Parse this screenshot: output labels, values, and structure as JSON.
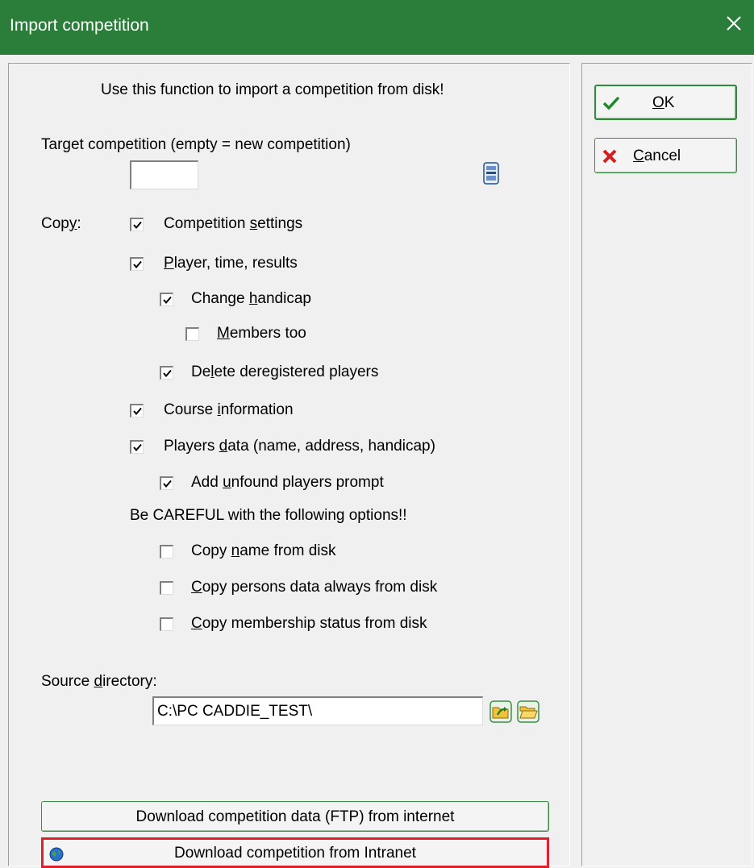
{
  "window": {
    "title": "Import competition",
    "close_glyph": "×"
  },
  "colors": {
    "titlebar": "#2b7d3a",
    "highlight_border": "#e0202a",
    "button_border": "#3a8f43"
  },
  "intro_text": "Use this function to import a competition from disk!",
  "target": {
    "label": "Target competition (empty = new competition)",
    "value": "",
    "picker_icon": "list-picker-icon"
  },
  "copy": {
    "label_prefix": "Cop",
    "label_mnemonic": "y",
    "label_suffix": ":",
    "options": [
      {
        "pre": "Competition ",
        "mn": "s",
        "post": "ettings",
        "checked": true
      },
      {
        "pre": "",
        "mn": "P",
        "post": "layer, time, results",
        "checked": true
      },
      {
        "pre": "Change ",
        "mn": "h",
        "post": "andicap",
        "checked": true
      },
      {
        "pre": "",
        "mn": "M",
        "post": "embers too",
        "checked": false
      },
      {
        "pre": "De",
        "mn": "l",
        "post": "ete deregistered players",
        "checked": true
      },
      {
        "pre": "Course ",
        "mn": "i",
        "post": "nformation",
        "checked": true
      },
      {
        "pre": "Players ",
        "mn": "d",
        "post": "ata (name, address, handicap)",
        "checked": true
      },
      {
        "pre": "Add ",
        "mn": "u",
        "post": "nfound players prompt",
        "checked": true
      },
      {
        "pre": "Copy ",
        "mn": "n",
        "post": "ame from disk",
        "checked": false
      },
      {
        "pre": "",
        "mn": "C",
        "post": "opy persons data always from disk",
        "checked": false
      },
      {
        "pre": "",
        "mn": "C",
        "post": "opy membership status from disk",
        "checked": false
      }
    ],
    "warning": "Be CAREFUL with the following options!!"
  },
  "source": {
    "label_pre": "Source ",
    "label_mn": "d",
    "label_post": "irectory:",
    "value": "C:\\PC CADDIE_TEST\\",
    "icons": [
      "folder-arrow-icon",
      "folder-open-icon"
    ]
  },
  "buttons": {
    "ok_mn": "O",
    "ok_post": "K",
    "cancel_mn": "C",
    "cancel_post": "ancel",
    "ftp": "Download competition data (FTP) from internet",
    "intranet": "Download competition from Intranet"
  }
}
